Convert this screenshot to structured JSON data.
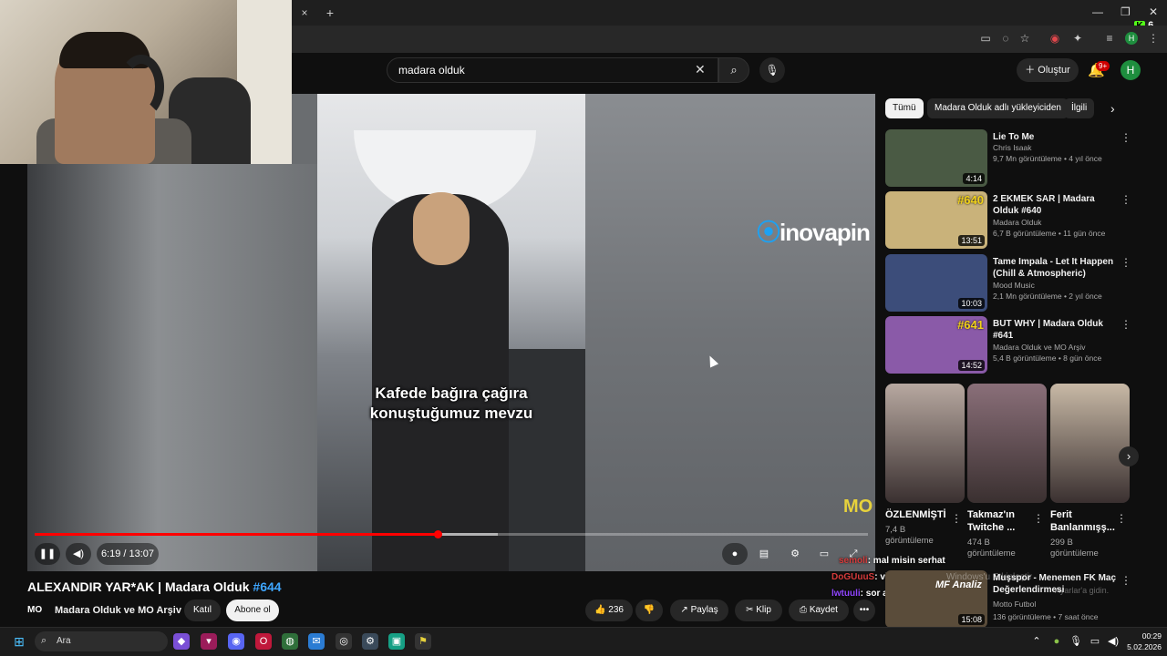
{
  "webcam": {
    "label": "streamer webcam"
  },
  "browser": {
    "tab_close": "×",
    "tab_new": "+",
    "window_controls": [
      "—",
      "❐",
      "✕"
    ],
    "kick_badge_count": "6",
    "kick_badge_letter": "K",
    "profile_initial": "H"
  },
  "youtube": {
    "search_query": "madara olduk",
    "create_label": "Oluştur",
    "notifications": "9+",
    "avatar_initial": "H"
  },
  "player": {
    "subtitle_line1": "Kafede bağıra çağıra",
    "subtitle_line2": "konuştuğumuz mevzu",
    "sponsor_text": "inovapin",
    "watermark": "MO",
    "time": "6:19 / 13:07",
    "progress": 0.484,
    "buffered": 0.556
  },
  "chat": [
    {
      "nick": "semoli",
      "text": ": mal misin serhat"
    },
    {
      "nick": "DoGUuuS",
      "text": ": vida acccc"
    },
    {
      "nick": "lwtuuli",
      "text": ": sor amk bana"
    }
  ],
  "video": {
    "title": "ALEXANDIR YAR*AK | Madara Olduk",
    "tag": "#644",
    "channel_logo": "MO",
    "channel": "Madara Olduk ve MO Arşiv",
    "join": "Katıl",
    "subscribe": "Abone ol",
    "likes": "236",
    "share": "Paylaş",
    "clip": "Klip",
    "save": "Kaydet",
    "more": "•••"
  },
  "chips": [
    "Tümü",
    "Madara Olduk adlı yükleyiciden",
    "İlgili"
  ],
  "recommendations": [
    {
      "title": "Lie To Me",
      "channel": "Chris Isaak",
      "meta": "9,7 Mn görüntüleme • 4 yıl önce",
      "duration": "4:14",
      "color": "#4a5a44"
    },
    {
      "title": "2 EKMEK SAR | Madara Olduk #640",
      "channel": "Madara Olduk",
      "meta": "6,7 B görüntüleme • 11 gün önce",
      "duration": "13:51",
      "badge": "#640",
      "color": "#c9b27a"
    },
    {
      "title": "Tame Impala - Let It Happen (Chill & Atmospheric)",
      "channel": "Mood Music",
      "meta": "2,1 Mn görüntüleme • 2 yıl önce",
      "duration": "10:03",
      "color": "#3c4d7a"
    },
    {
      "title": "BUT WHY | Madara Olduk #641",
      "channel": "Madara Olduk ve MO Arşiv",
      "meta": "5,4 B görüntüleme • 8 gün önce",
      "duration": "14:52",
      "badge": "#641",
      "color": "#8a5aa8"
    }
  ],
  "shorts": [
    {
      "title": "ÖZLENMİŞTİ",
      "views": "7,4 B görüntüleme",
      "color": "#b7a8a0"
    },
    {
      "title": "Takmaz'ın Twitche ...",
      "views": "474 B görüntüleme",
      "color": "#8a6f79"
    },
    {
      "title": "Ferit Banlanmışş...",
      "views": "299 B görüntüleme",
      "color": "#c8b9a6"
    }
  ],
  "bottom_rec": {
    "title": "Muşspor - Menemen FK Maç Değerlendirmesi",
    "channel": "Motto Futbol",
    "meta": "136 görüntüleme • 7 saat önce",
    "duration": "15:08",
    "thumb_text": "MF Analiz"
  },
  "windows_watermark": "Windows'u Etkinleştir",
  "windows_watermark2": "Ayarlar'a gidin.",
  "taskbar": {
    "search": "Ara",
    "time": "00:29",
    "date": "5.02.2026"
  }
}
